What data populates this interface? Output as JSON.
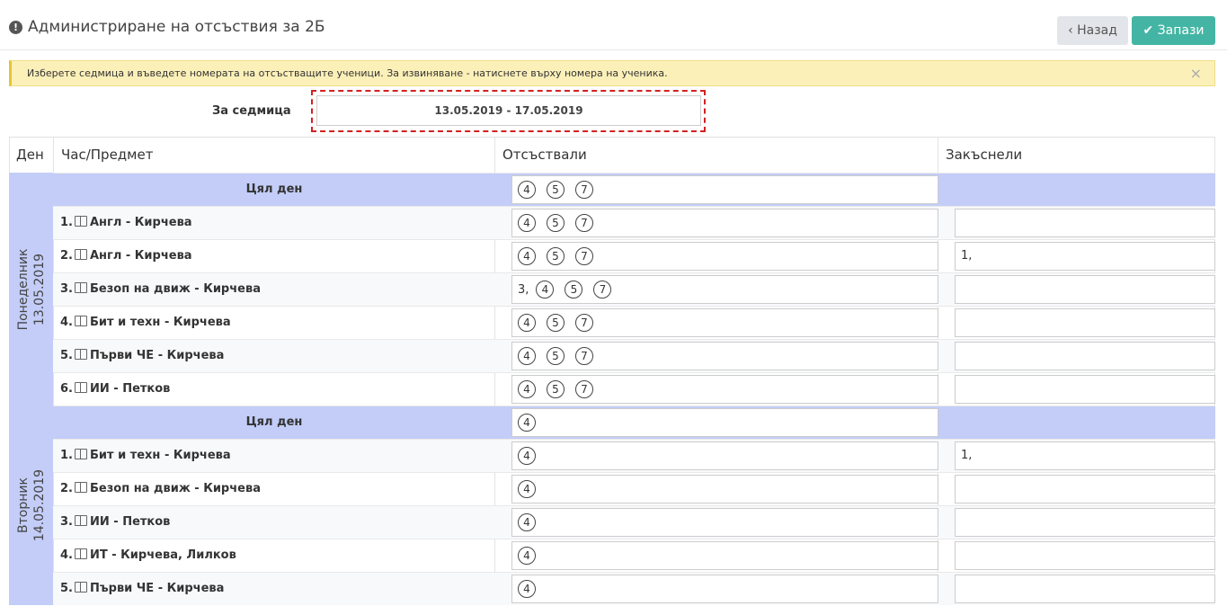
{
  "header": {
    "title": "Администриране на отсъствия за 2Б",
    "back_label": "Назад",
    "save_label": "Запази"
  },
  "alert": {
    "text": "Изберете седмица и въведете номерата на отсъстващите ученици. За извиняване - натиснете върху номера на ученика.",
    "close": "×"
  },
  "week": {
    "label": "За седмица",
    "value": "13.05.2019 - 17.05.2019"
  },
  "columns": [
    "Ден",
    "Час/Предмет",
    "Отсъствали",
    "Закъснели"
  ],
  "days": [
    {
      "name": "Понеделник",
      "date": "13.05.2019",
      "full_day": {
        "label": "Цял ден",
        "absent": [
          "4",
          "5",
          "7"
        ]
      },
      "lessons": [
        {
          "num": "1.",
          "subject": "Англ - Кирчева",
          "absent_prefix": "",
          "absent": [
            "4",
            "5",
            "7"
          ],
          "late": ""
        },
        {
          "num": "2.",
          "subject": "Англ - Кирчева",
          "absent_prefix": "",
          "absent": [
            "4",
            "5",
            "7"
          ],
          "late": "1,"
        },
        {
          "num": "3.",
          "subject": "Безоп на движ - Кирчева",
          "absent_prefix": "3,",
          "absent": [
            "4",
            "5",
            "7"
          ],
          "late": ""
        },
        {
          "num": "4.",
          "subject": "Бит и техн - Кирчева",
          "absent_prefix": "",
          "absent": [
            "4",
            "5",
            "7"
          ],
          "late": ""
        },
        {
          "num": "5.",
          "subject": "Първи ЧЕ - Кирчева",
          "absent_prefix": "",
          "absent": [
            "4",
            "5",
            "7"
          ],
          "late": ""
        },
        {
          "num": "6.",
          "subject": "ИИ - Петков",
          "absent_prefix": "",
          "absent": [
            "4",
            "5",
            "7"
          ],
          "late": ""
        }
      ]
    },
    {
      "name": "Вторник",
      "date": "14.05.2019",
      "full_day": {
        "label": "Цял ден",
        "absent": [
          "4"
        ]
      },
      "lessons": [
        {
          "num": "1.",
          "subject": "Бит и техн - Кирчева",
          "absent_prefix": "",
          "absent": [
            "4"
          ],
          "late": "1,"
        },
        {
          "num": "2.",
          "subject": "Безоп на движ - Кирчева",
          "absent_prefix": "",
          "absent": [
            "4"
          ],
          "late": ""
        },
        {
          "num": "3.",
          "subject": "ИИ - Петков",
          "absent_prefix": "",
          "absent": [
            "4"
          ],
          "late": ""
        },
        {
          "num": "4.",
          "subject": "ИТ - Кирчева, Лилков",
          "absent_prefix": "",
          "absent": [
            "4"
          ],
          "late": ""
        },
        {
          "num": "5.",
          "subject": "Първи ЧЕ - Кирчева",
          "absent_prefix": "",
          "absent": [
            "4"
          ],
          "late": ""
        }
      ]
    }
  ]
}
